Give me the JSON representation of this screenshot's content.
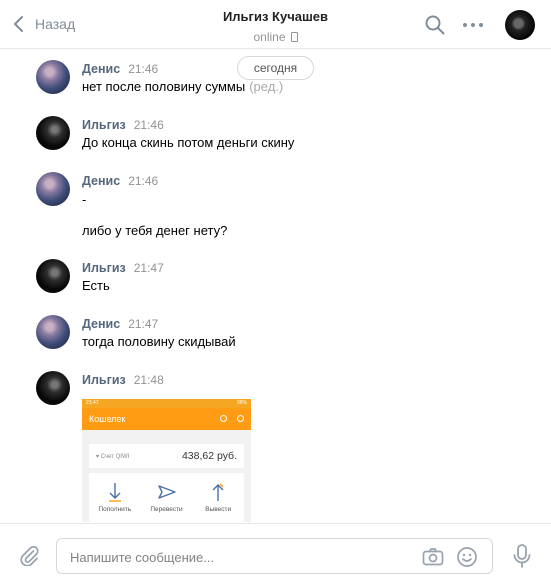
{
  "header": {
    "back_label": "Назад",
    "title": "Ильгиз Кучашев",
    "status": "online"
  },
  "date_divider": "сегодня",
  "messages": [
    {
      "author": "Денис",
      "time": "21:46",
      "lines": [
        "нет после половину суммы"
      ],
      "edited": "(ред.)",
      "avatar": "denis"
    },
    {
      "author": "Ильгиз",
      "time": "21:46",
      "lines": [
        "До конца скинь потом деньги скину"
      ],
      "avatar": "ilgiz"
    },
    {
      "author": "Денис",
      "time": "21:46",
      "lines": [
        "-",
        "либо у тебя денег нету?"
      ],
      "avatar": "denis"
    },
    {
      "author": "Ильгиз",
      "time": "21:47",
      "lines": [
        "Есть"
      ],
      "avatar": "ilgiz"
    },
    {
      "author": "Денис",
      "time": "21:47",
      "lines": [
        "тогда половину скидывай"
      ],
      "avatar": "denis"
    },
    {
      "author": "Ильгиз",
      "time": "21:48",
      "lines": [],
      "avatar": "ilgiz",
      "attachment": "photo"
    }
  ],
  "attachment": {
    "status_time": "23:47",
    "status_battery": "98%",
    "app_title": "Кошелек",
    "account_label": "Счет QIWI",
    "balance": "438,62 руб.",
    "actions": [
      "Пополнить",
      "Перевести",
      "Вывести"
    ]
  },
  "composer": {
    "placeholder": "Напишите сообщение..."
  },
  "icons": {
    "back": "chevron-left-icon",
    "search": "search-icon",
    "more": "more-horizontal-icon",
    "attach": "paperclip-icon",
    "camera": "camera-icon",
    "emoji": "smile-icon",
    "mic": "microphone-icon"
  },
  "colors": {
    "author": "#55677d",
    "qiwi_orange": "#ff9c13",
    "icon_gray": "#818c99"
  }
}
